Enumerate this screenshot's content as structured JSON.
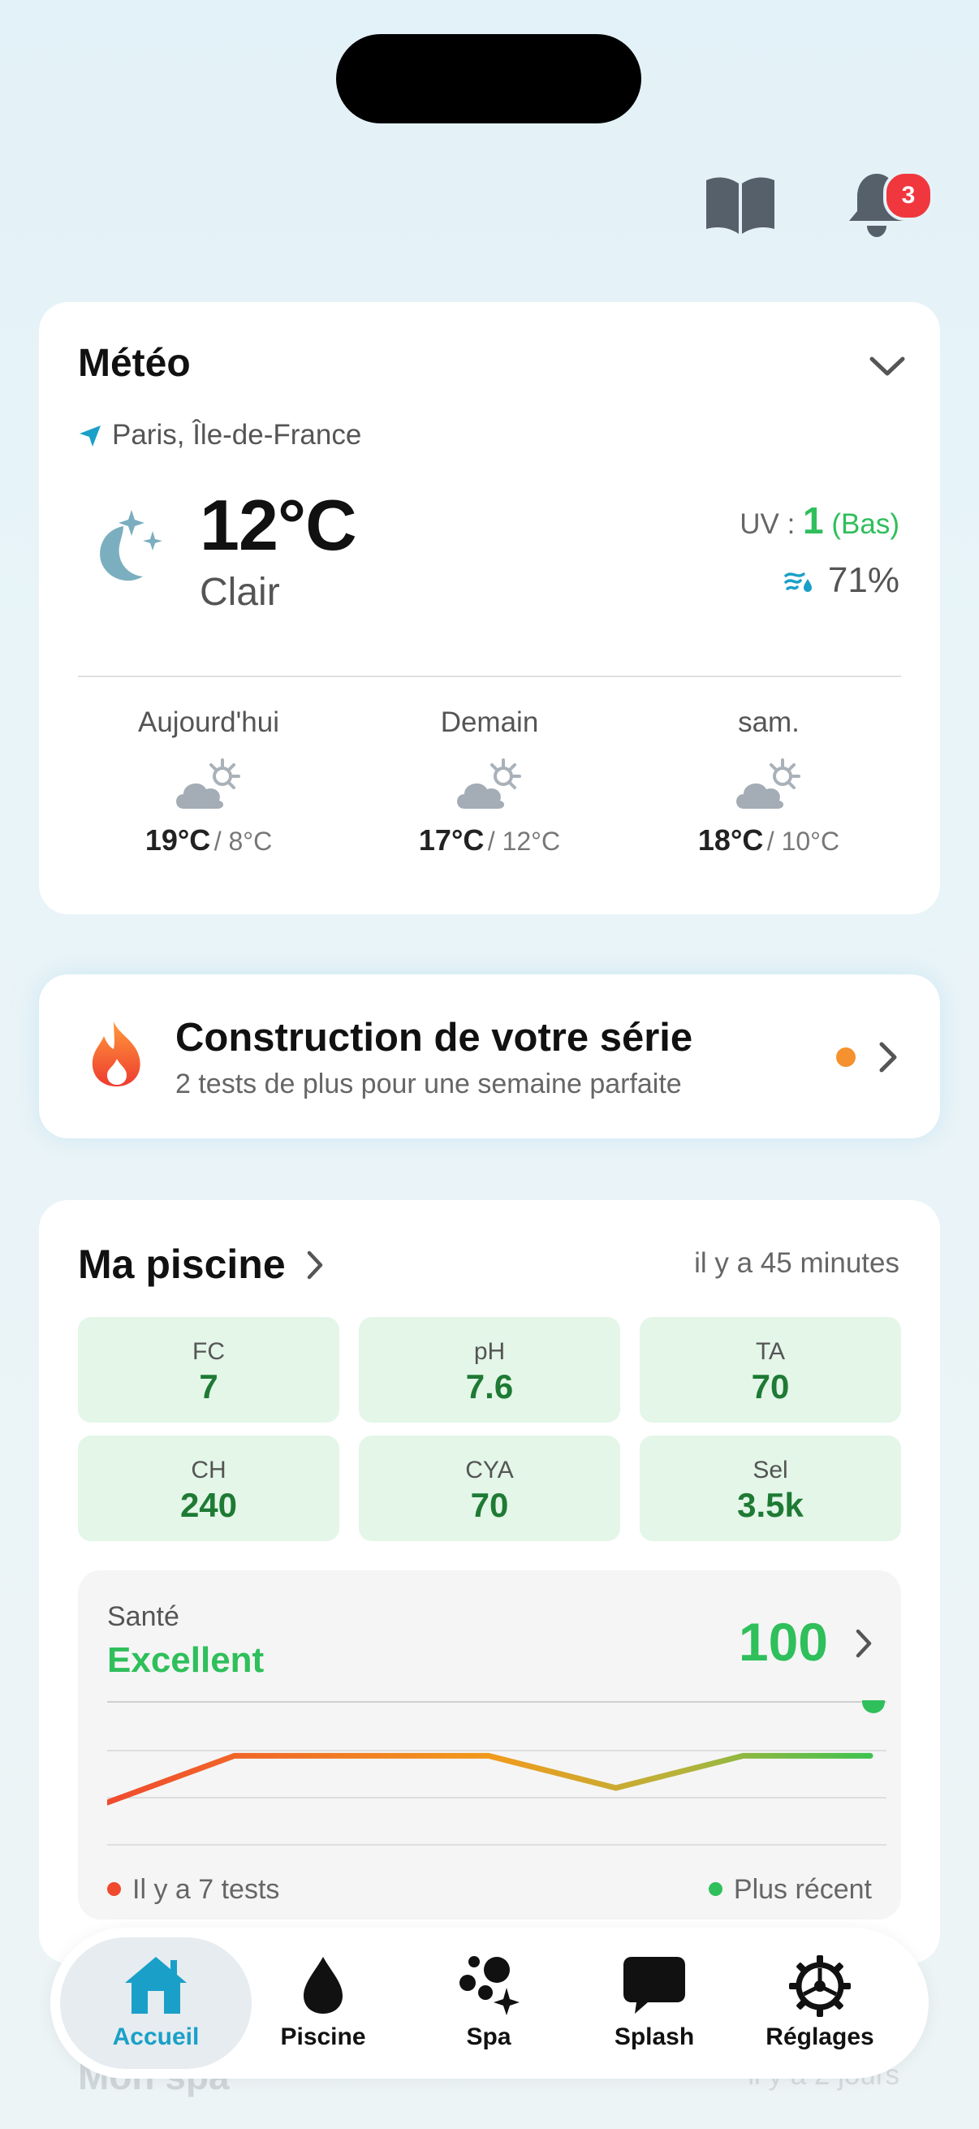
{
  "header": {
    "notification_count": "3",
    "icons": [
      "book-icon",
      "bell-icon"
    ]
  },
  "weather": {
    "title": "Météo",
    "location": "Paris, Île-de-France",
    "temperature": "12°C",
    "condition": "Clair",
    "uv_label": "UV :",
    "uv_value": "1",
    "uv_level": "(Bas)",
    "humidity": "71%",
    "forecast": [
      {
        "day": "Aujourd'hui",
        "high": "19°C",
        "low": "/ 8°C"
      },
      {
        "day": "Demain",
        "high": "17°C",
        "low": "/ 12°C"
      },
      {
        "day": "sam.",
        "high": "18°C",
        "low": "/ 10°C"
      }
    ]
  },
  "streak": {
    "title": "Construction de votre série",
    "subtitle": "2 tests de plus pour une semaine parfaite"
  },
  "pool": {
    "title": "Ma piscine",
    "updated": "il y a 45 minutes",
    "readings": [
      {
        "label": "FC",
        "value": "7"
      },
      {
        "label": "pH",
        "value": "7.6"
      },
      {
        "label": "TA",
        "value": "70"
      },
      {
        "label": "CH",
        "value": "240"
      },
      {
        "label": "CYA",
        "value": "70"
      },
      {
        "label": "Sel",
        "value": "3.5k"
      }
    ],
    "health": {
      "label": "Santé",
      "status": "Excellent",
      "score": "100",
      "legend_left": "Il y a 7 tests",
      "legend_right": "Plus récent",
      "trend": [
        30,
        62,
        62,
        62,
        40,
        62,
        62
      ]
    }
  },
  "peek": {
    "title": "Mon spa",
    "right": "il y a 2 jours"
  },
  "nav": {
    "items": [
      {
        "label": "Accueil",
        "icon": "home-icon"
      },
      {
        "label": "Piscine",
        "icon": "drop-icon"
      },
      {
        "label": "Spa",
        "icon": "bubbles-icon"
      },
      {
        "label": "Splash",
        "icon": "chat-icon"
      },
      {
        "label": "Réglages",
        "icon": "gear-icon"
      }
    ]
  },
  "colors": {
    "accent": "#1aa0c8",
    "good": "#2fbf5b",
    "alert": "#f0373e"
  }
}
